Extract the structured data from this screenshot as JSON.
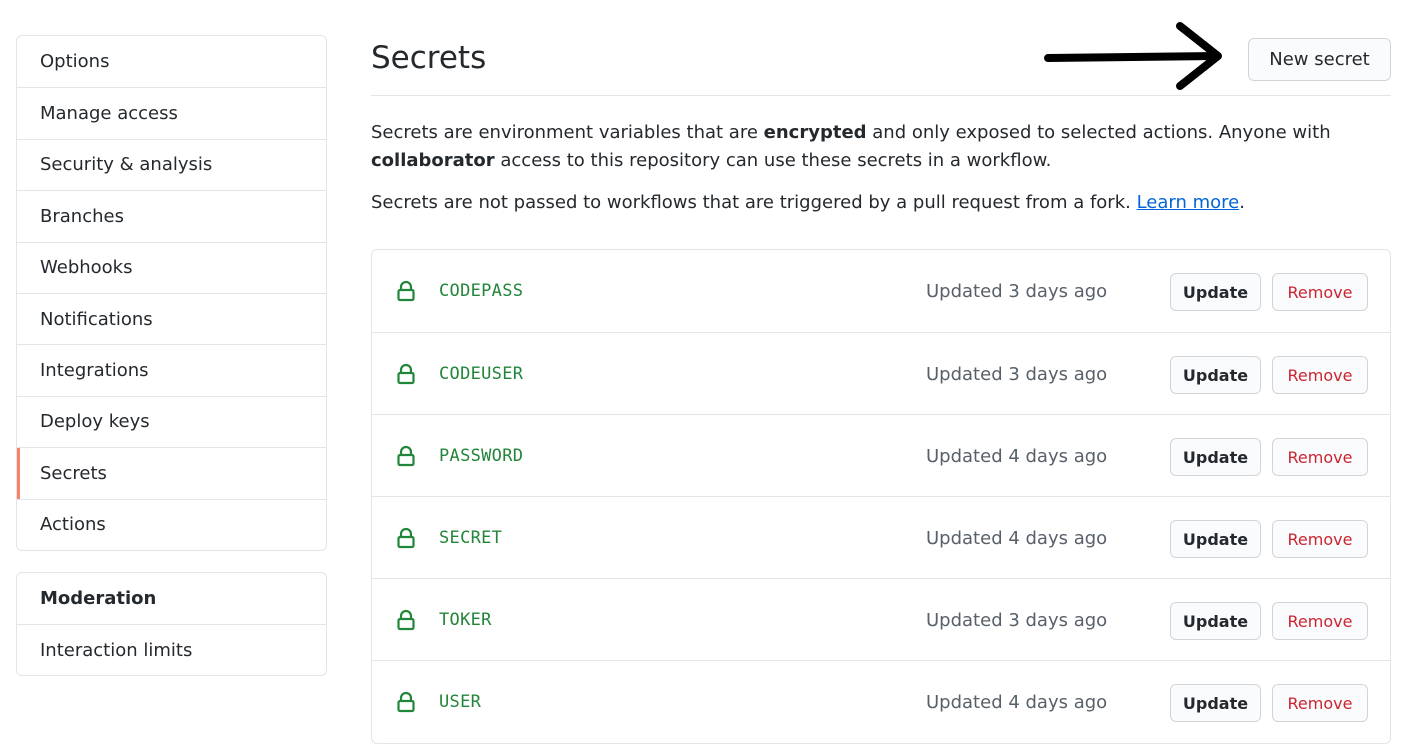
{
  "sidebar": {
    "items": [
      {
        "label": "Options"
      },
      {
        "label": "Manage access"
      },
      {
        "label": "Security & analysis"
      },
      {
        "label": "Branches"
      },
      {
        "label": "Webhooks"
      },
      {
        "label": "Notifications"
      },
      {
        "label": "Integrations"
      },
      {
        "label": "Deploy keys"
      },
      {
        "label": "Secrets",
        "selected": true
      },
      {
        "label": "Actions"
      }
    ],
    "moderation": {
      "heading": "Moderation",
      "items": [
        {
          "label": "Interaction limits"
        }
      ]
    }
  },
  "main": {
    "title": "Secrets",
    "new_secret_label": "New secret",
    "description": {
      "part1": "Secrets are environment variables that are ",
      "bold1": "encrypted",
      "part2": " and only exposed to selected actions. Anyone with ",
      "bold2": "collaborator",
      "part3": " access to this repository can use these secrets in a workflow.",
      "line2": "Secrets are not passed to workflows that are triggered by a pull request from a fork. ",
      "link": "Learn more",
      "after_link": "."
    },
    "secrets": [
      {
        "name": "CODEPASS",
        "updated": "Updated 3 days ago"
      },
      {
        "name": "CODEUSER",
        "updated": "Updated 3 days ago"
      },
      {
        "name": "PASSWORD",
        "updated": "Updated 4 days ago"
      },
      {
        "name": "SECRET",
        "updated": "Updated 4 days ago"
      },
      {
        "name": "TOKER",
        "updated": "Updated 3 days ago"
      },
      {
        "name": "USER",
        "updated": "Updated 4 days ago"
      }
    ],
    "update_label": "Update",
    "remove_label": "Remove"
  },
  "colors": {
    "selected_accent": "#f9826c",
    "secret_name": "#22863a",
    "remove": "#cb2431",
    "link": "#0366d6"
  },
  "icons": {
    "lock": "lock-icon",
    "annotation": "arrow-right-icon"
  }
}
